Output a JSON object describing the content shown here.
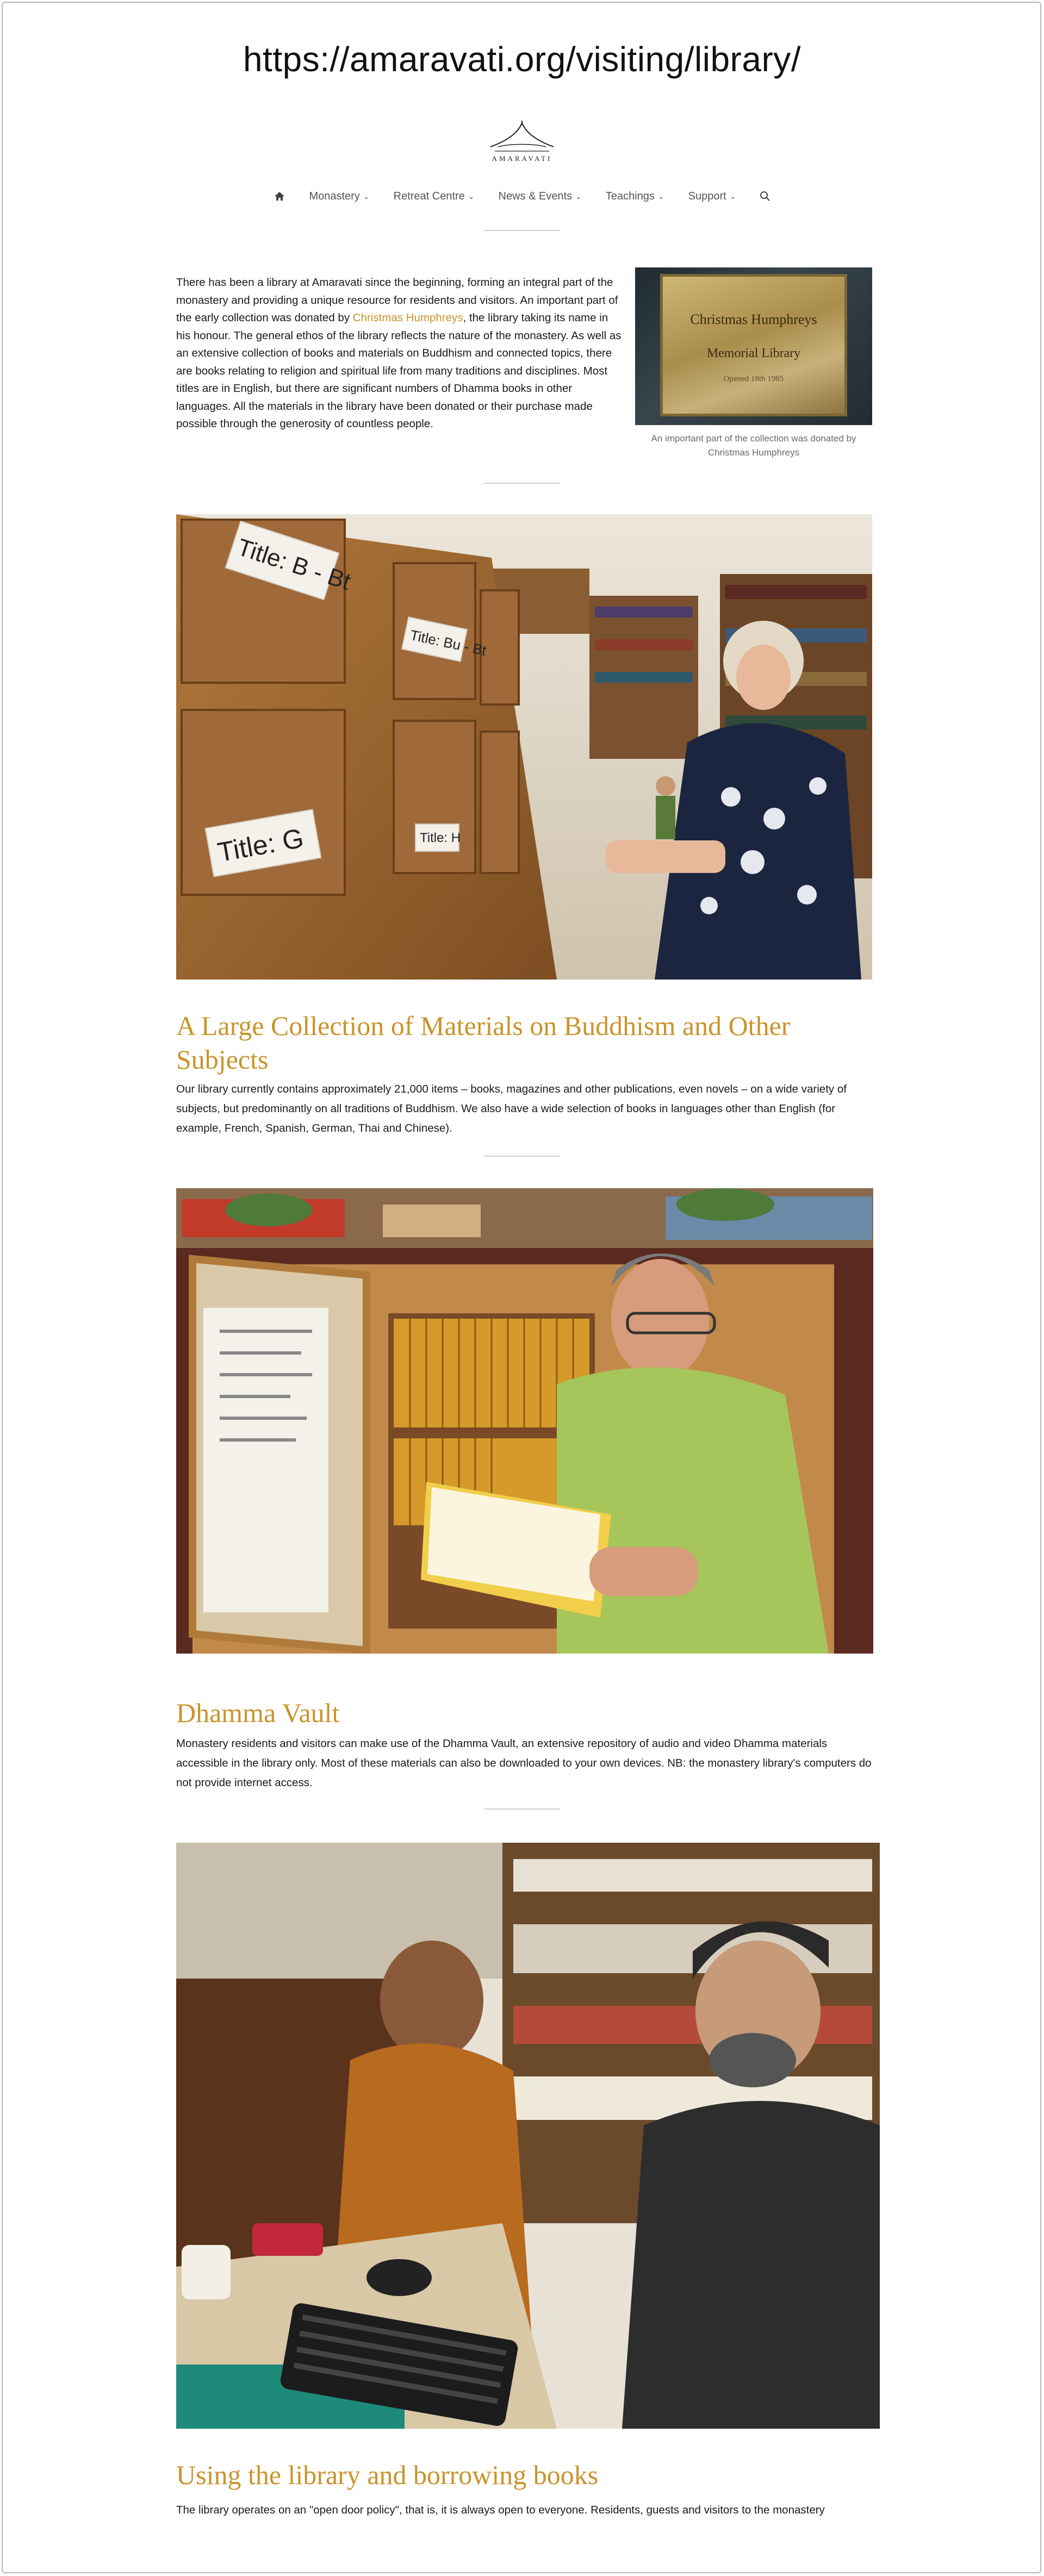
{
  "browser": {
    "url": "https://amaravati.org/visiting/library/"
  },
  "logo": {
    "text": "AMARAVATI"
  },
  "nav": {
    "items": [
      {
        "label": "Monastery"
      },
      {
        "label": "Retreat Centre"
      },
      {
        "label": "News & Events"
      },
      {
        "label": "Teachings"
      },
      {
        "label": "Support"
      }
    ]
  },
  "intro": {
    "before_link": "There has been a library at Amaravati since the beginning, forming an integral part of the monastery and providing a unique resource for residents and visitors. An important part of the early collection was donated by ",
    "link": "Christmas Humphreys",
    "after_link": ", the library taking its name in his honour. The general ethos of the library reflects the nature of the monastery. As well as an extensive collection of books and materials on Buddhism and connected topics, there are books relating to religion and spiritual life from many traditions and disciplines. Most titles are in English, but there are significant numbers of Dhamma books in other languages. All the materials in the library have been donated or their purchase made possible through the generosity of countless people."
  },
  "plaque": {
    "line1": "Christmas Humphreys",
    "line2": "Memorial Library",
    "line3": "Opened 18th 1985"
  },
  "caption": "An important part of the collection was donated by Christmas Humphreys",
  "photo1": {
    "labels": [
      "Title: B - Bt",
      "Title: G",
      "Title: Bu - Bt",
      "Title: H"
    ]
  },
  "section1": {
    "heading": "A Large Collection of Materials on Buddhism and Other Subjects",
    "text": "Our library currently contains approximately 21,000 items – books, magazines and other publications, even novels – on a wide variety of subjects, but predominantly on all traditions of Buddhism. We also have a wide selection of books in languages other than English (for example, French, Spanish, German, Thai and Chinese)."
  },
  "section2": {
    "heading": "Dhamma Vault",
    "text": "Monastery residents and visitors can make use of the Dhamma Vault, an extensive repository of audio and video Dhamma materials accessible in the library only. Most of these materials can also be downloaded to your own devices. NB: the monastery library's computers do not provide internet access."
  },
  "section3": {
    "heading": "Using the library and borrowing books",
    "text": "The library operates on an \"open door policy\", that is, it is always open to everyone. Residents, guests and visitors to the monastery"
  },
  "colors": {
    "accent": "#c9942c",
    "text": "#1a1a1a",
    "nav": "#555555"
  },
  "icons": [
    "home-icon",
    "chevron-down-icon",
    "search-icon"
  ]
}
